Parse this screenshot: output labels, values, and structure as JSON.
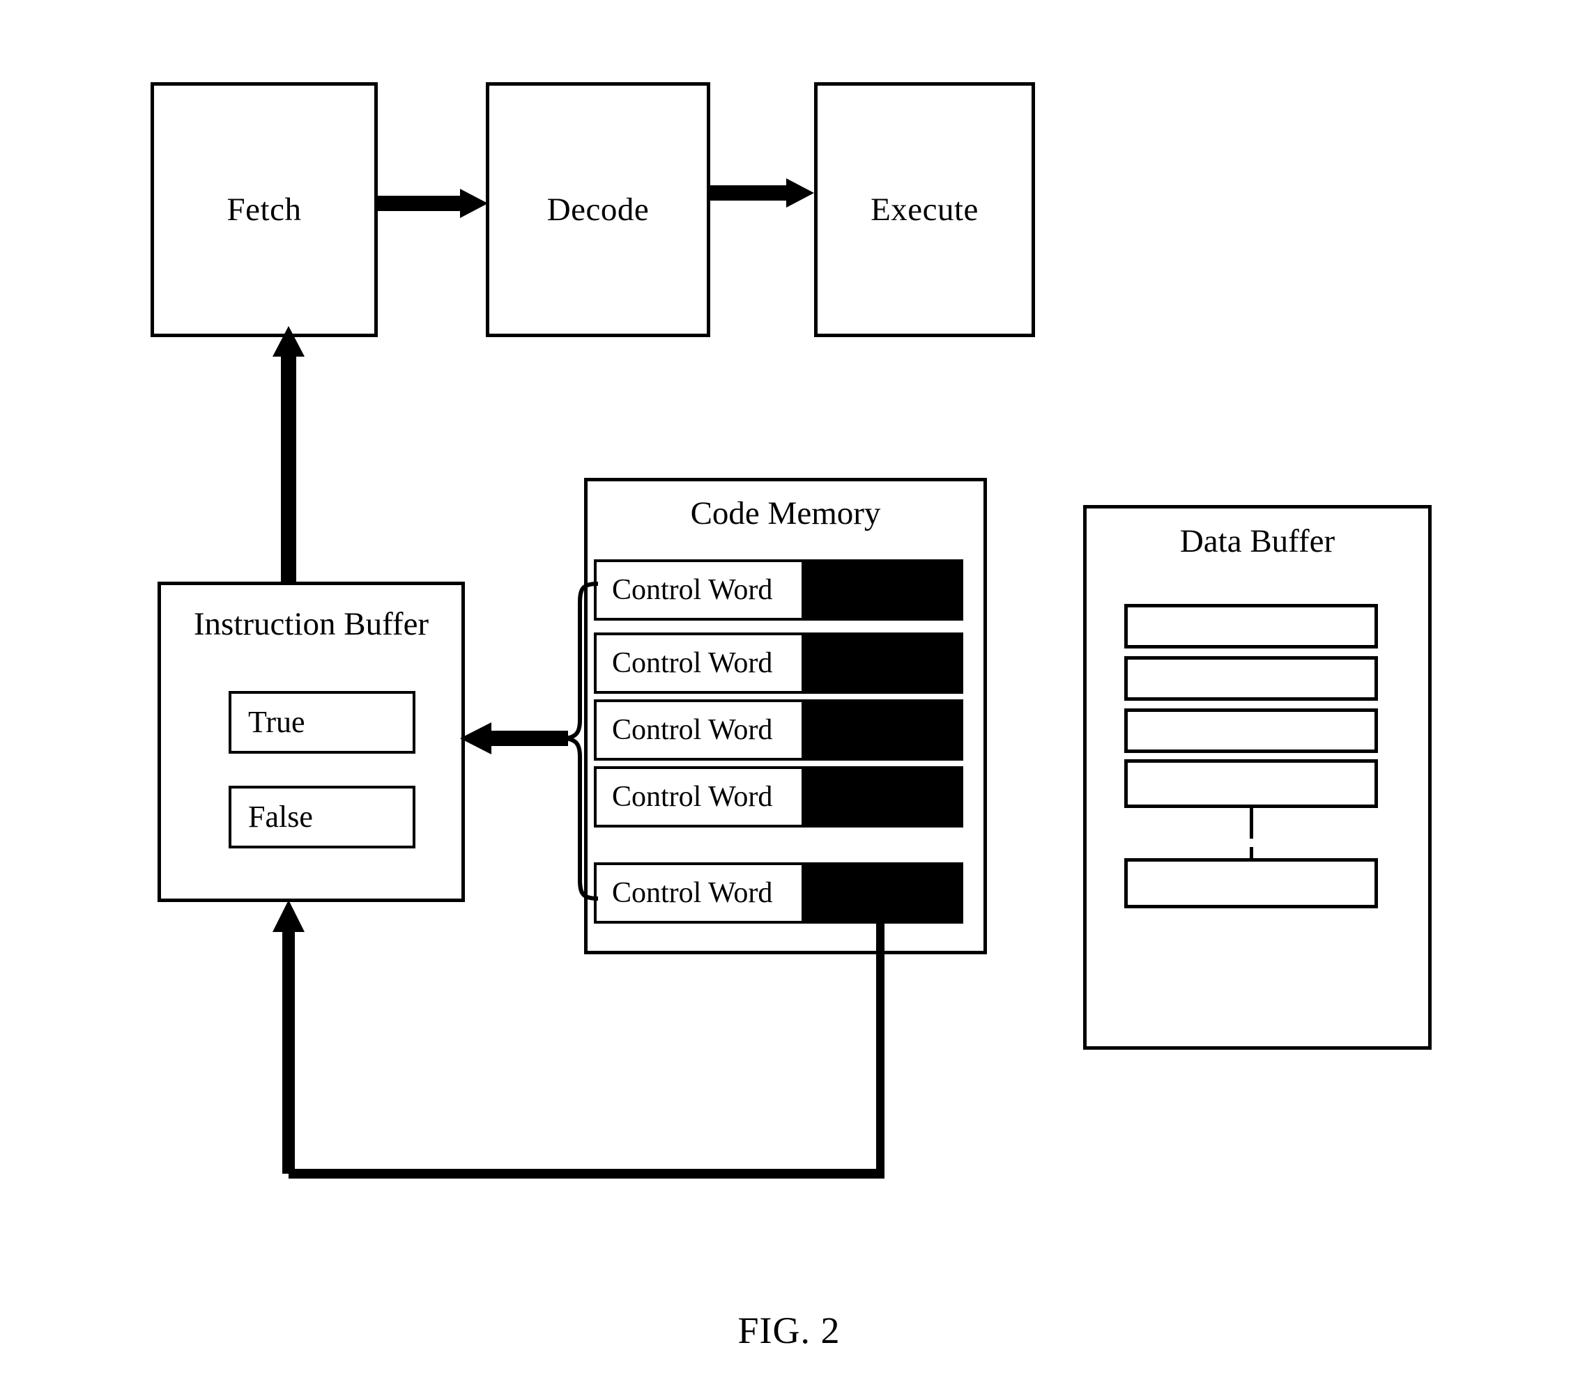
{
  "figure": {
    "caption": "FIG. 2"
  },
  "pipeline": {
    "stages": [
      {
        "label": "Fetch"
      },
      {
        "label": "Decode"
      },
      {
        "label": "Execute"
      }
    ]
  },
  "instruction_buffer": {
    "title": "Instruction Buffer",
    "entries": [
      {
        "label": "True"
      },
      {
        "label": "False"
      }
    ]
  },
  "code_memory": {
    "title": "Code Memory",
    "rows": [
      {
        "label": "Control Word"
      },
      {
        "label": "Control Word"
      },
      {
        "label": "Control Word"
      },
      {
        "label": "Control Word"
      },
      {
        "label": "Control Word"
      }
    ]
  },
  "data_buffer": {
    "title": "Data Buffer",
    "rows": [
      {
        "label": ""
      },
      {
        "label": ""
      },
      {
        "label": ""
      },
      {
        "label": ""
      },
      {
        "label": ""
      }
    ]
  },
  "connectors": {
    "fetch_to_decode": "arrow-right",
    "decode_to_execute": "arrow-right",
    "instruction_buffer_to_fetch": "arrow-up",
    "code_memory_to_instruction_buffer": "arrow-left",
    "code_memory_feedback_to_instruction_buffer": "arrow-up",
    "code_memory_brace": "curly-brace",
    "data_buffer_row_link": "vertical-connector"
  },
  "colors": {
    "stroke": "#000000",
    "fill": "#ffffff",
    "block": "#000000"
  }
}
